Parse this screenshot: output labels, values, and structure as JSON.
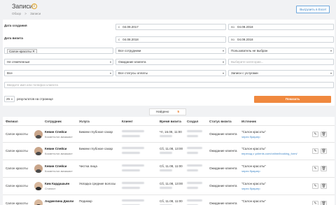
{
  "header": {
    "title": "Записи",
    "breadcrumb": [
      "Обзор",
      ">",
      "Записи"
    ],
    "export_label": "Выгрузить в Excel"
  },
  "filters": {
    "created_label": "Дата создания",
    "visit_label": "Дата визита",
    "created_from_prefix": "с",
    "created_from": "04.09.2017",
    "created_to_prefix": "по",
    "created_to": "04.09.2018",
    "visit_from_prefix": "с",
    "visit_from": "04.08.2018",
    "visit_to_prefix": "по",
    "visit_to": "04.09.2018",
    "branch_tag": "Салон красоты ✕",
    "employees": "Все сотрудники",
    "created_by": "Пользователь не выбран",
    "mark": "Не отмеченные",
    "visit_status": "Ожидание клиента",
    "category_placeholder": "Выберите категории...",
    "all": "Все",
    "payment_status": "Все статусы оплаты",
    "services": "Записи с услугами",
    "client_search_placeholder": "Введите имя или телефон клиента",
    "per_page_value": "25",
    "per_page_label": "результатов на странице",
    "show_label": "Показать"
  },
  "found": {
    "label": "Найдено",
    "count": "5"
  },
  "table": {
    "headers": [
      "Филиал",
      "Сотрудник",
      "Услуга",
      "Клиент",
      "Время визита",
      "Создал",
      "Статус визита",
      "Источник"
    ],
    "rows": [
      {
        "branch": "Салон красоты",
        "employee": "Кевин Спейси",
        "role": "Косметолог-визажист",
        "service": "Бикини глубокое сахар",
        "time": "Чт, 16.08, 11:00",
        "status": "Ожидание клиента",
        "source": "\"Салон красоты\"",
        "source_sub": "через браузер",
        "female": false
      },
      {
        "branch": "Салон красоты",
        "employee": "Кевин Спейси",
        "role": "Косметолог-визажист",
        "service": "Бикини глубокое сахар",
        "time": "Сб, 11.08, 13:00",
        "status": "Ожидание клиента",
        "source": "\"Салон красоты\"",
        "source_sub": "переход с yclients.com/online/booking_form/...",
        "female": false
      },
      {
        "branch": "Салон красоты",
        "employee": "Кевин Спейси",
        "role": "Косметолог-визажист",
        "service": "Чистка лица",
        "time": "Сб, 11.08, 11:00",
        "status": "Ожидание клиента",
        "source": "\"Салон красоты\"",
        "source_sub": "через браузер",
        "female": false
      },
      {
        "branch": "Салон красоты",
        "employee": "Ким Кардашьян",
        "role": "Стилист",
        "service": "Укладка средние волосы",
        "time": "Сб, 11.08, 13:00",
        "status": "Ожидание клиента",
        "source": "\"Салон красоты\"",
        "source_sub": "через браузер",
        "female": true
      },
      {
        "branch": "Салон красоты",
        "employee": "Анджелина Джоли",
        "role": "Мастер по маникюру",
        "service": "Педикюр",
        "time": "Сб, 11.08, 11:00",
        "status": "Ожидание клиента",
        "source": "\"Салон красоты\"",
        "source_sub": "через браузер",
        "female": true
      }
    ]
  },
  "colors": {
    "accent": "#f0883e",
    "link": "#3d85c6"
  },
  "icons": {
    "info": "info-icon",
    "edit": "pencil-icon",
    "delete": "trash-icon",
    "chevron": "chevron-down-icon"
  }
}
